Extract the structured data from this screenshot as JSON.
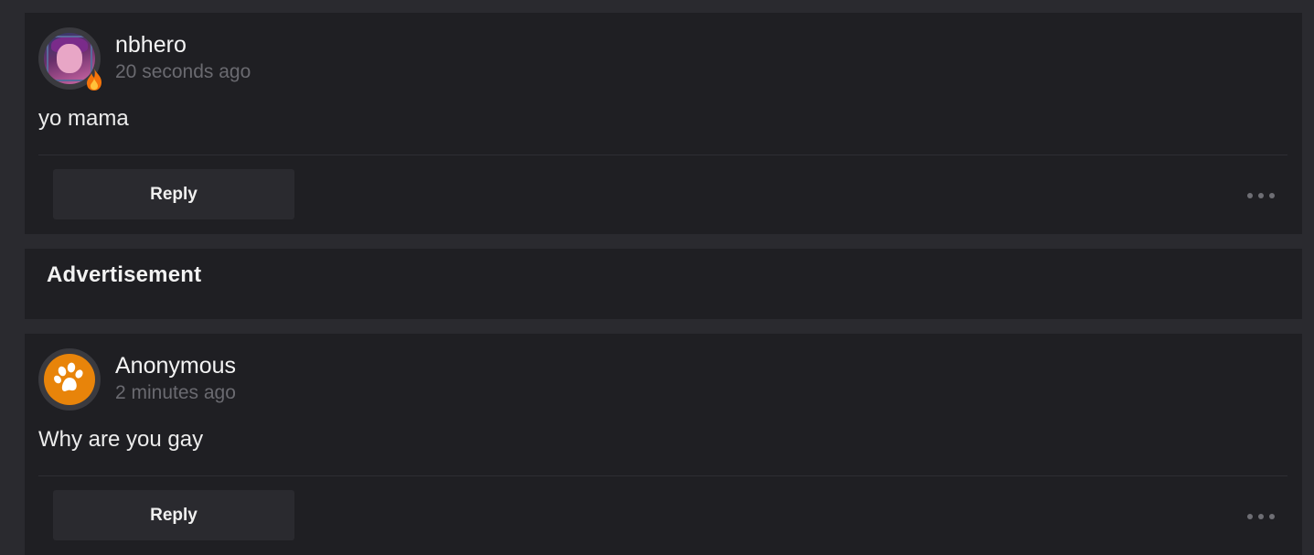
{
  "comments": [
    {
      "username": "nbhero",
      "time": "20 seconds ago",
      "text": "yo mama",
      "reply_label": "Reply",
      "avatar_icon": "user-avatar-image",
      "badge_icon": "fire-icon"
    },
    {
      "username": "Anonymous",
      "time": "2 minutes ago",
      "text": "Why are you gay",
      "reply_label": "Reply",
      "avatar_icon": "paw-icon",
      "avatar_color": "#e8840a"
    }
  ],
  "ad": {
    "title": "Advertisement"
  },
  "colors": {
    "page_bg": "#2a2a2f",
    "card_bg": "#1f1f23",
    "muted_text": "#6a6a70"
  }
}
